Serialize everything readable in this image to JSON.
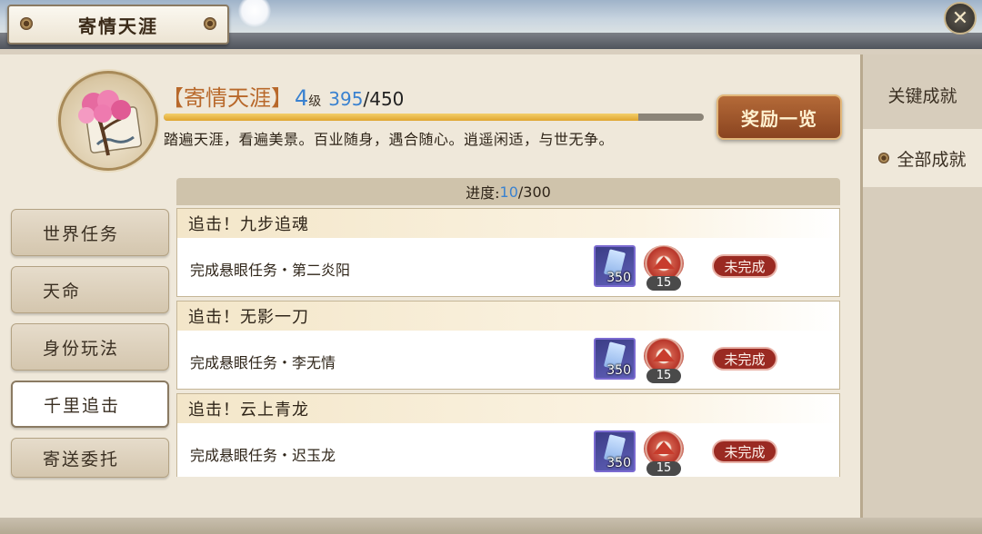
{
  "header": {
    "title": "寄情天涯",
    "close_label": "✕"
  },
  "side_tabs": [
    {
      "label": "关键成就",
      "active": false
    },
    {
      "label": "全部成就",
      "active": true
    }
  ],
  "achievement": {
    "name": "【寄情天涯】",
    "level": "4",
    "level_unit": "级",
    "points_current": "395",
    "points_sep": "/",
    "points_max": "450",
    "progress_fraction": 0.878,
    "description": "踏遍天涯，看遍美景。百业随身，遇合随心。逍遥闲适，与世无争。"
  },
  "reward_button": "奖励一览",
  "categories": [
    {
      "label": "世界任务",
      "active": false
    },
    {
      "label": "天命",
      "active": false
    },
    {
      "label": "身份玩法",
      "active": false
    },
    {
      "label": "千里追击",
      "active": true
    },
    {
      "label": "寄送委托",
      "active": false
    }
  ],
  "progress": {
    "label": "进度:",
    "current": "10",
    "sep": "/",
    "total": "300"
  },
  "tasks": [
    {
      "title": "追击！九步追魂",
      "task": "完成悬眼任务・第二炎阳",
      "reward1_qty": "350",
      "reward2_qty": "15",
      "status": "未完成"
    },
    {
      "title": "追击！无影一刀",
      "task": "完成悬眼任务・李无情",
      "reward1_qty": "350",
      "reward2_qty": "15",
      "status": "未完成"
    },
    {
      "title": "追击！云上青龙",
      "task": "完成悬眼任务・迟玉龙",
      "reward1_qty": "350",
      "reward2_qty": "15",
      "status": "未完成"
    }
  ],
  "colors": {
    "accent_blue": "#3a82d0",
    "title_orange": "#b8682a",
    "status_red": "#9a2a22",
    "reward_button": "#8a4420"
  }
}
